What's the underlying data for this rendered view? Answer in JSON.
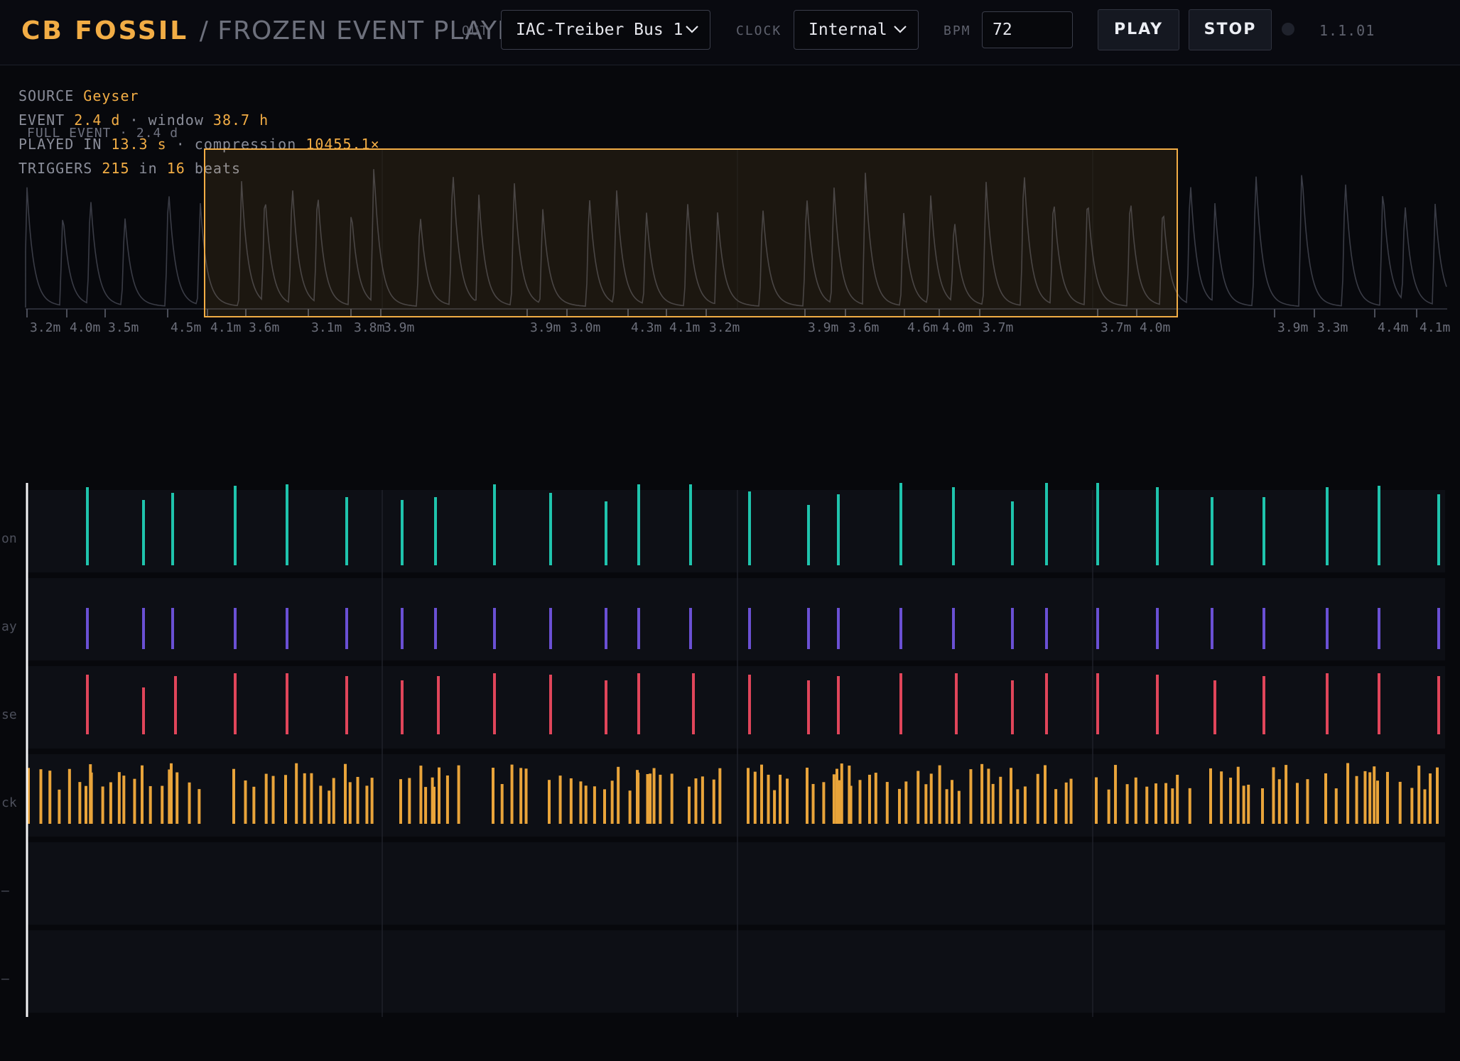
{
  "header": {
    "brand": "CB FOSSIL",
    "subtitle": "/ FROZEN EVENT PLAYER",
    "out_label": "OUT",
    "out_value": "IAC-Treiber Bus 1",
    "clock_label": "CLOCK",
    "clock_value": "Internal",
    "bpm_label": "BPM",
    "bpm_value": "72",
    "play_label": "PLAY",
    "stop_label": "STOP",
    "version": "1.1.01"
  },
  "info": {
    "source_label": "SOURCE",
    "source_value": "Geyser",
    "event_label": "EVENT",
    "event_value": "2.4 d",
    "window_label": "· window",
    "window_value": "38.7 h",
    "full_event": "FULL EVENT · 2.4 d",
    "played_label": "PLAYED IN",
    "played_value": "13.3 s",
    "compression_label": "· compression",
    "compression_value": "10455.1×",
    "triggers_label": "TRIGGERS",
    "triggers_value": "215",
    "in_label": "in",
    "beats_value": "16",
    "beats_label": "beats"
  },
  "overview": {
    "window_color": "#f2ad45",
    "tick_labels": [
      "3.2m",
      "4.0m",
      "3.5m",
      "4.5m",
      "4.1m",
      "3.6m",
      "3.1m",
      "3.8m",
      "3.9m",
      "3.9m",
      "3.0m",
      "4.3m",
      "4.1m",
      "3.2m",
      "3.9m",
      "3.6m",
      "4.6m",
      "4.0m",
      "3.7m",
      "3.7m",
      "4.0m",
      "3.9m",
      "3.3m",
      "4.4m",
      "4.1m"
    ]
  },
  "lanes": [
    {
      "label": "on",
      "color": "#1fc4ad"
    },
    {
      "label": "ay",
      "color": "#6a50d4"
    },
    {
      "label": "se",
      "color": "#e0455a"
    },
    {
      "label": "ck",
      "color": "#e9a43a"
    },
    {
      "label": "–",
      "color": "#2a2c36"
    },
    {
      "label": "–",
      "color": "#2a2c36"
    }
  ],
  "icons": {
    "out_chevron": "chevron-down-icon",
    "clock_chevron": "chevron-down-icon",
    "status": "status-dot-icon"
  }
}
